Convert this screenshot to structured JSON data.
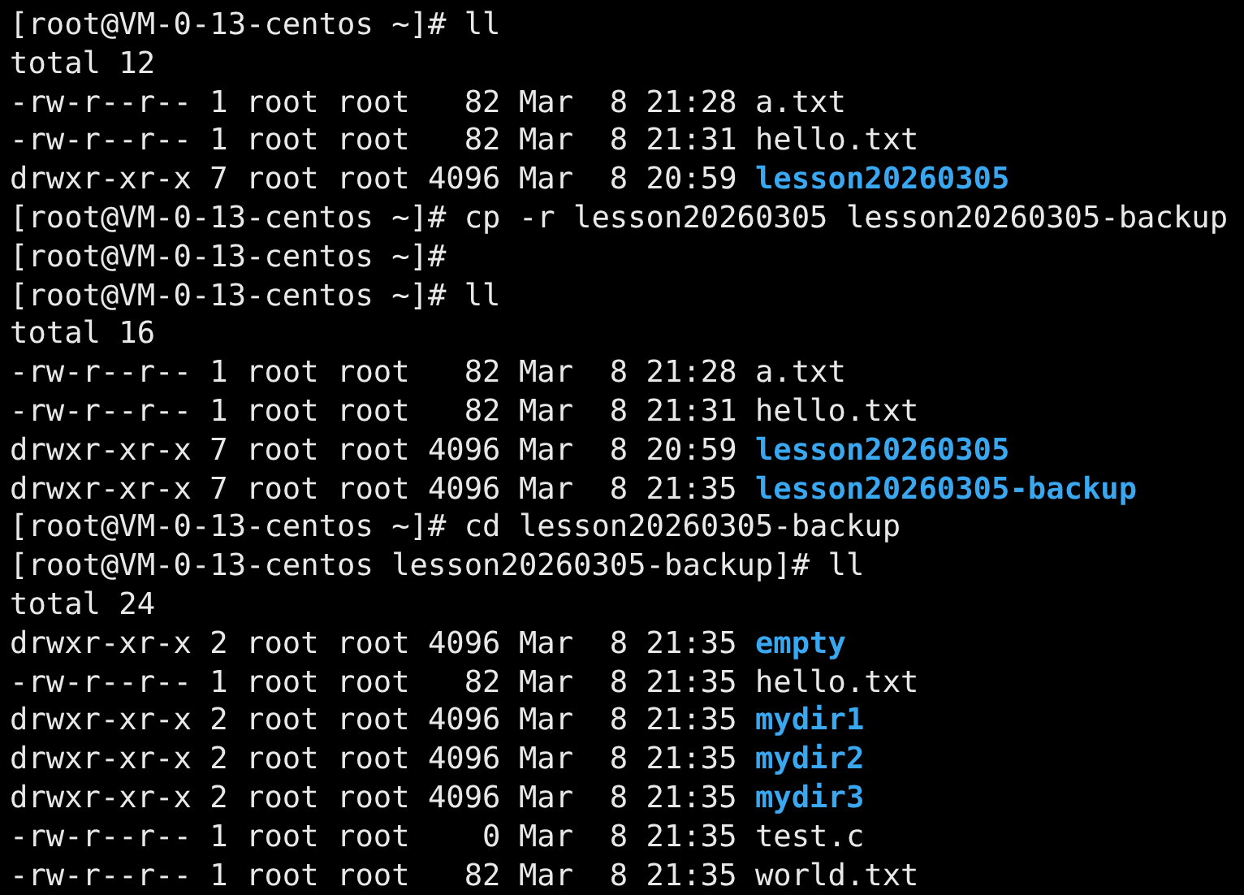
{
  "terminal": {
    "lines": [
      {
        "kind": "prompt",
        "text": "[root@VM-0-13-centos ~]# ll"
      },
      {
        "kind": "output",
        "text": "total 12"
      },
      {
        "kind": "entry",
        "meta": "-rw-r--r-- 1 root root   82 Mar  8 21:28",
        "name": "a.txt",
        "directory": false
      },
      {
        "kind": "entry",
        "meta": "-rw-r--r-- 1 root root   82 Mar  8 21:31",
        "name": "hello.txt",
        "directory": false
      },
      {
        "kind": "entry",
        "meta": "drwxr-xr-x 7 root root 4096 Mar  8 20:59",
        "name": "lesson20260305",
        "directory": true
      },
      {
        "kind": "prompt",
        "text": "[root@VM-0-13-centos ~]# cp -r lesson20260305 lesson20260305-backup"
      },
      {
        "kind": "prompt",
        "text": "[root@VM-0-13-centos ~]#"
      },
      {
        "kind": "prompt",
        "text": "[root@VM-0-13-centos ~]# ll"
      },
      {
        "kind": "output",
        "text": "total 16"
      },
      {
        "kind": "entry",
        "meta": "-rw-r--r-- 1 root root   82 Mar  8 21:28",
        "name": "a.txt",
        "directory": false
      },
      {
        "kind": "entry",
        "meta": "-rw-r--r-- 1 root root   82 Mar  8 21:31",
        "name": "hello.txt",
        "directory": false
      },
      {
        "kind": "entry",
        "meta": "drwxr-xr-x 7 root root 4096 Mar  8 20:59",
        "name": "lesson20260305",
        "directory": true
      },
      {
        "kind": "entry",
        "meta": "drwxr-xr-x 7 root root 4096 Mar  8 21:35",
        "name": "lesson20260305-backup",
        "directory": true
      },
      {
        "kind": "prompt",
        "text": "[root@VM-0-13-centos ~]# cd lesson20260305-backup"
      },
      {
        "kind": "prompt",
        "text": "[root@VM-0-13-centos lesson20260305-backup]# ll"
      },
      {
        "kind": "output",
        "text": "total 24"
      },
      {
        "kind": "entry",
        "meta": "drwxr-xr-x 2 root root 4096 Mar  8 21:35",
        "name": "empty",
        "directory": true
      },
      {
        "kind": "entry",
        "meta": "-rw-r--r-- 1 root root   82 Mar  8 21:35",
        "name": "hello.txt",
        "directory": false
      },
      {
        "kind": "entry",
        "meta": "drwxr-xr-x 2 root root 4096 Mar  8 21:35",
        "name": "mydir1",
        "directory": true
      },
      {
        "kind": "entry",
        "meta": "drwxr-xr-x 2 root root 4096 Mar  8 21:35",
        "name": "mydir2",
        "directory": true
      },
      {
        "kind": "entry",
        "meta": "drwxr-xr-x 2 root root 4096 Mar  8 21:35",
        "name": "mydir3",
        "directory": true
      },
      {
        "kind": "entry",
        "meta": "-rw-r--r-- 1 root root    0 Mar  8 21:35",
        "name": "test.c",
        "directory": false
      },
      {
        "kind": "entry",
        "meta": "-rw-r--r-- 1 root root   82 Mar  8 21:35",
        "name": "world.txt",
        "directory": false
      }
    ]
  }
}
